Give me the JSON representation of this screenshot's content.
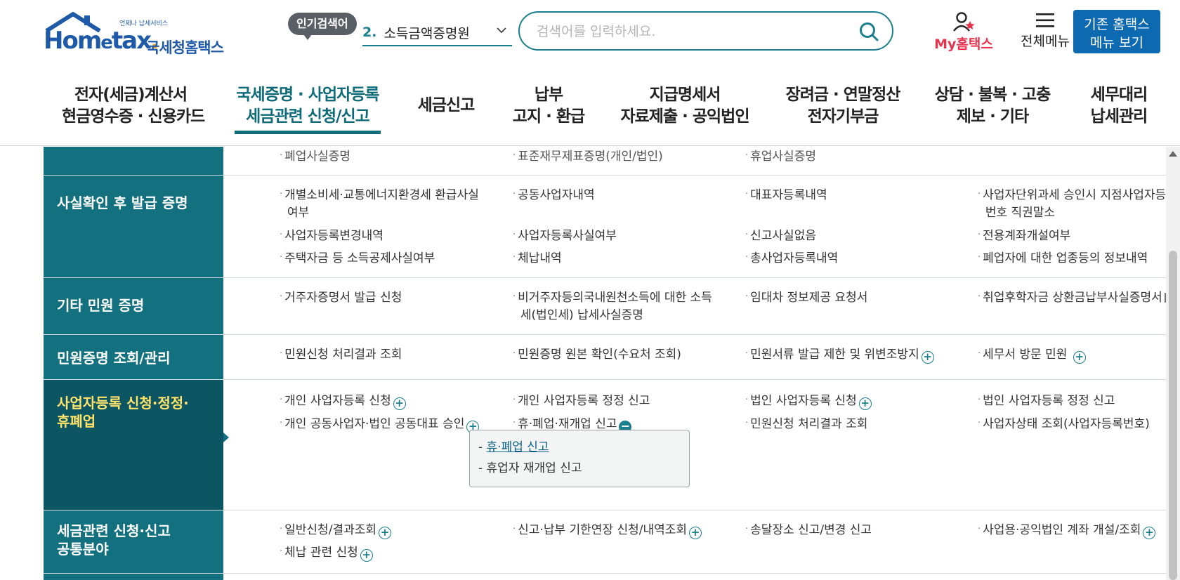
{
  "header": {
    "logo_word_a": "Hom",
    "logo_word_b": "e",
    "logo_word_c": "tax",
    "logo_word_d": ".",
    "logo_tagline": "언제나 납세서비스",
    "logo_kr": "국세청홈택스",
    "popular_badge": "인기검색어",
    "popular_rank": "2.",
    "popular_term": "소득금액증명원",
    "search_placeholder": "검색어를 입력하세요.",
    "my_hometax": "My홈택스",
    "all_menu": "전체메뉴",
    "old_menu_line1": "기존 홈택스",
    "old_menu_line2": "메뉴 보기"
  },
  "gnb": [
    {
      "line1": "전자(세금)계산서",
      "line2": "현금영수증 · 신용카드",
      "active": false
    },
    {
      "line1": "국세증명 · 사업자등록",
      "line2": "세금관련 신청/신고",
      "active": true
    },
    {
      "line1": "세금신고",
      "line2": "",
      "active": false
    },
    {
      "line1": "납부",
      "line2": "고지 · 환급",
      "active": false
    },
    {
      "line1": "지급명세서",
      "line2": "자료제출 · 공익법인",
      "active": false
    },
    {
      "line1": "장려금 · 연말정산",
      "line2": "전자기부금",
      "active": false
    },
    {
      "line1": "상담 · 불복 · 고충",
      "line2": "제보 · 기타",
      "active": false
    },
    {
      "line1": "세무대리",
      "line2": "납세관리",
      "active": false
    }
  ],
  "rows": [
    {
      "head": "",
      "items": [
        "폐업사실증명",
        "표준재무제표증명(개인/법인)",
        "휴업사실증명"
      ]
    },
    {
      "head": "사실확인 후 발급 증명",
      "items": [
        "개별소비세·교통에너지환경세 환급사실",
        "여부",
        "공동사업자내역",
        "대표자등록내역",
        "사업자단위과세 승인시 지점사업자등록",
        "번호 직권말소",
        "사업자등록변경내역",
        "사업자등록사실여부",
        "신고사실없음",
        "전용계좌개설여부",
        "주택자금 등 소득공제사실여부",
        "체납내역",
        "총사업자등록내역",
        "폐업자에 대한 업종등의 정보내역"
      ]
    },
    {
      "head": "기타 민원 증명",
      "items": [
        "거주자증명서 발급 신청",
        "비거주자등의국내원천소득에 대한 소득",
        "세(법인세) 납세사실증명",
        "임대차 정보제공 요청서",
        "취업후학자금 상환금납부사실증명서"
      ]
    },
    {
      "head": "민원증명 조회/관리",
      "items": [
        "민원신청 처리결과 조회",
        "민원증명 원본 확인(수요처 조회)",
        "민원서류 발급 제한 및 위변조방지",
        "세무서 방문 민원"
      ]
    },
    {
      "head_line1": "사업자등록 신청·정정·",
      "head_line2": "휴폐업",
      "items": [
        "개인 사업자등록 신청",
        "개인 사업자등록 정정 신고",
        "법인 사업자등록 신청",
        "법인 사업자등록 정정 신고",
        "개인 공동사업자·법인 공동대표 승인",
        "휴·폐업·재개업 신고",
        "민원신청 처리결과 조회",
        "사업자상태 조회(사업자등록번호)"
      ],
      "submenu": [
        "휴·폐업 신고",
        "휴업자 재개업 신고"
      ]
    },
    {
      "head_line1": "세금관련 신청·신고",
      "head_line2": "공통분야",
      "items": [
        "일반신청/결과조회",
        "신고·납부 기한연장 신청/내역조회",
        "송달장소 신고/변경 신고",
        "사업용·공익법인 계좌 개설/조회",
        "체납 관련 신청"
      ]
    }
  ],
  "colors": {
    "teal": "#13707f",
    "dark_teal": "#0c5563",
    "accent_blue": "#0e6ab0",
    "highlight_yellow": "#ffe36b"
  }
}
